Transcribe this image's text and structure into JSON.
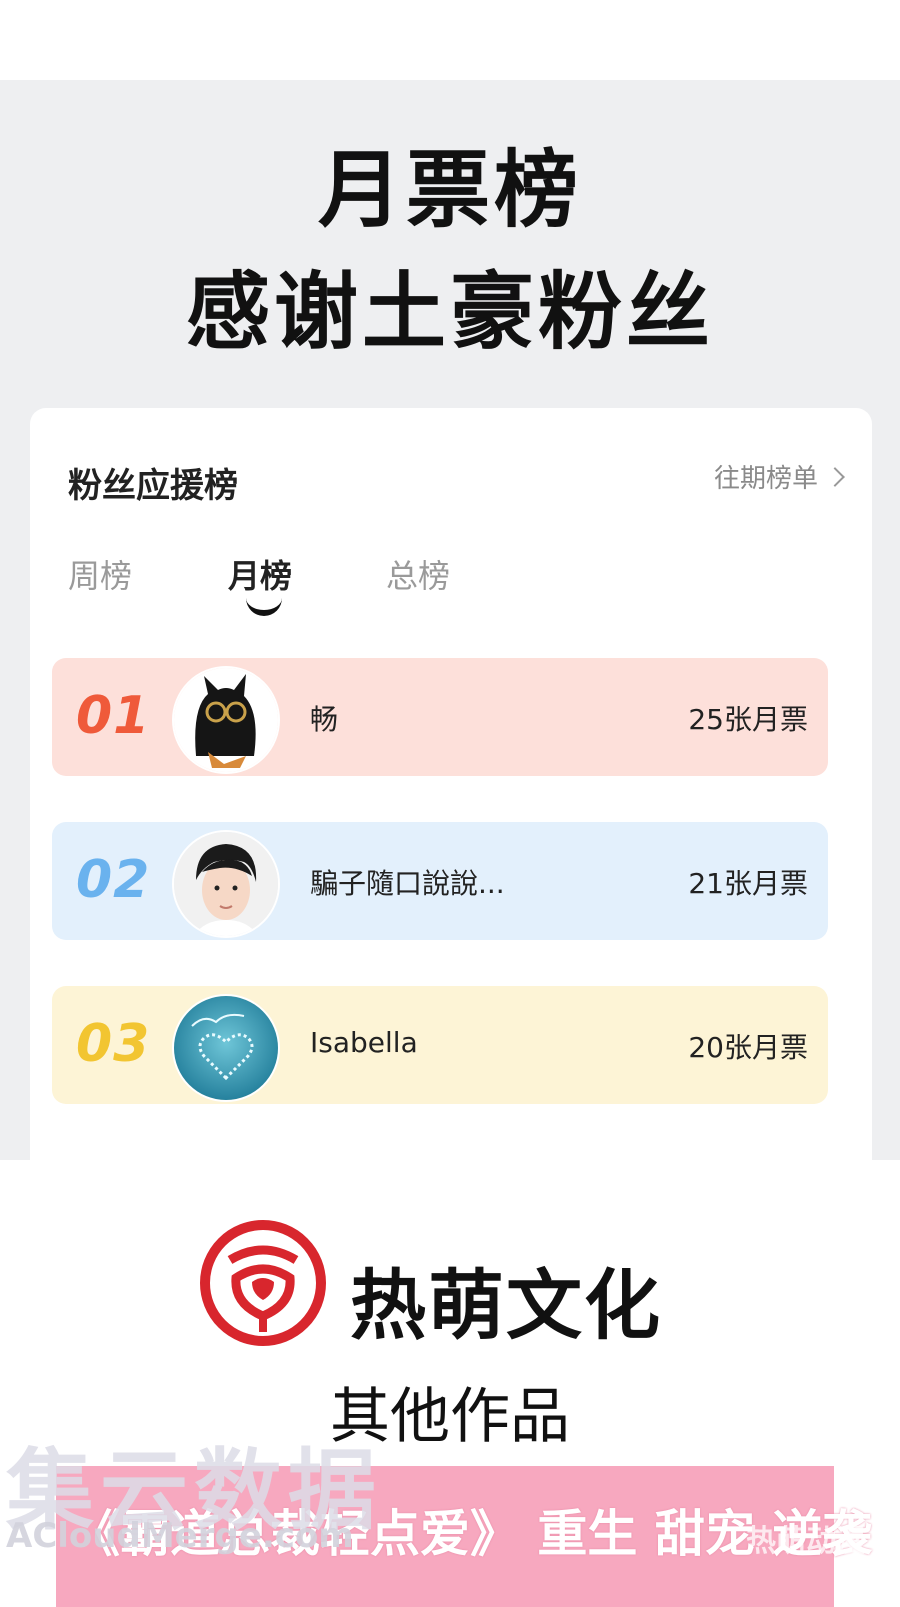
{
  "headline": {
    "line1": "月票榜",
    "line2": "感谢土豪粉丝"
  },
  "card": {
    "title": "粉丝应援榜",
    "past_link": "往期榜单",
    "tabs": [
      {
        "label": "周榜",
        "active": false
      },
      {
        "label": "月榜",
        "active": true
      },
      {
        "label": "总榜",
        "active": false
      }
    ],
    "ranks": [
      {
        "rank": "01",
        "name": "畅",
        "votes": "25张月票",
        "row_color": "#fde0da",
        "num_color": "#ef5a3a"
      },
      {
        "rank": "02",
        "name": "騙子隨口說說...",
        "votes": "21张月票",
        "row_color": "#e3f0fc",
        "num_color": "#6ab2ee"
      },
      {
        "rank": "03",
        "name": "Isabella",
        "votes": "20张月票",
        "row_color": "#fdf4d6",
        "num_color": "#f2c531"
      }
    ]
  },
  "brand": {
    "name": "热萌文化",
    "logo_color": "#d8262d"
  },
  "other_works_label": "其他作品",
  "promo": {
    "text": "《霸道总裁轻点爱》 重生 甜宠 逆袭"
  },
  "watermark": {
    "main": "集云数据",
    "sub": "ACloudMerge.com",
    "corner": "热萌动漫"
  }
}
